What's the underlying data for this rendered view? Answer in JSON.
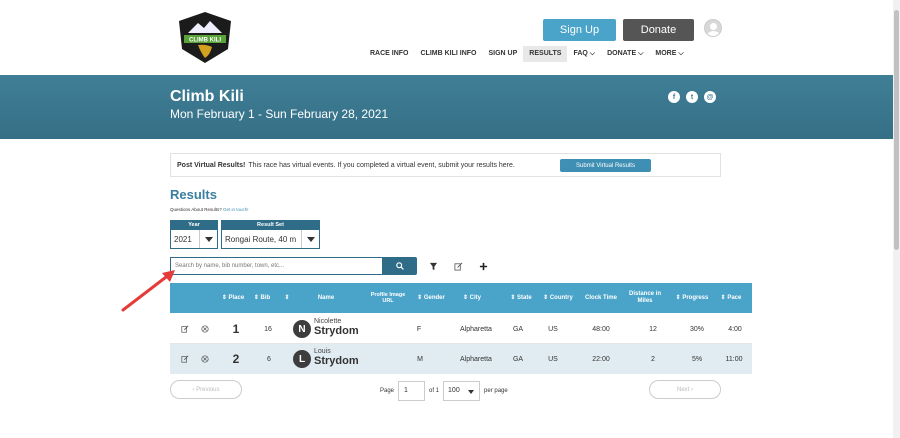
{
  "header": {
    "signup_label": "Sign Up",
    "donate_label": "Donate",
    "nav": [
      {
        "label": "RACE INFO"
      },
      {
        "label": "CLIMB KILI INFO"
      },
      {
        "label": "SIGN UP"
      },
      {
        "label": "RESULTS"
      },
      {
        "label": "FAQ ⌵"
      },
      {
        "label": "DONATE ⌵"
      },
      {
        "label": "MORE ⌵"
      }
    ]
  },
  "banner": {
    "title": "Climb Kili",
    "dates": "Mon February 1 - Sun February 28, 2021",
    "social": [
      "f",
      "t",
      "@"
    ]
  },
  "notice": {
    "bold": "Post Virtual Results!",
    "text": "This race has virtual events. If you completed a virtual event, submit your results here.",
    "button": "Submit Virtual Results"
  },
  "results": {
    "title": "Results",
    "questions": "Questions About Results?",
    "contact_link": "Get in touch!",
    "year_label": "Year",
    "year_value": "2021",
    "set_label": "Result Set",
    "set_value": "Rongai Route, 40 m",
    "search_placeholder": "Search by name, bib number, town, etc..."
  },
  "table": {
    "headers": {
      "place": "⇕ Place",
      "bib": "⇕ Bib",
      "sort": "⇕",
      "name": "Name",
      "profile": "Profile Image URL",
      "gender": "⇕ Gender",
      "city": "⇕ City",
      "state": "⇕ State",
      "country": "⇕ Country",
      "clock": "Clock Time",
      "distance": "Distance in Miles",
      "progress": "⇕ Progress",
      "pace": "⇕ Pace"
    },
    "rows": [
      {
        "place": "1",
        "bib": "16",
        "initial": "N",
        "first": "Nicolette",
        "last": "Strydom",
        "gender": "F",
        "city": "Alpharetta",
        "state": "GA",
        "country": "US",
        "clock": "48:00",
        "distance": "12",
        "progress": "30%",
        "pace": "4:00"
      },
      {
        "place": "2",
        "bib": "6",
        "initial": "L",
        "first": "Louis",
        "last": "Strydom",
        "gender": "M",
        "city": "Alpharetta",
        "state": "GA",
        "country": "US",
        "clock": "22:00",
        "distance": "2",
        "progress": "5%",
        "pace": "11:00"
      }
    ]
  },
  "pager": {
    "prev": "‹ Previous",
    "next": "Next ›",
    "page_label": "Page",
    "page_value": "1",
    "of_label": "of 1",
    "per_value": "100",
    "per_label": "per page"
  }
}
